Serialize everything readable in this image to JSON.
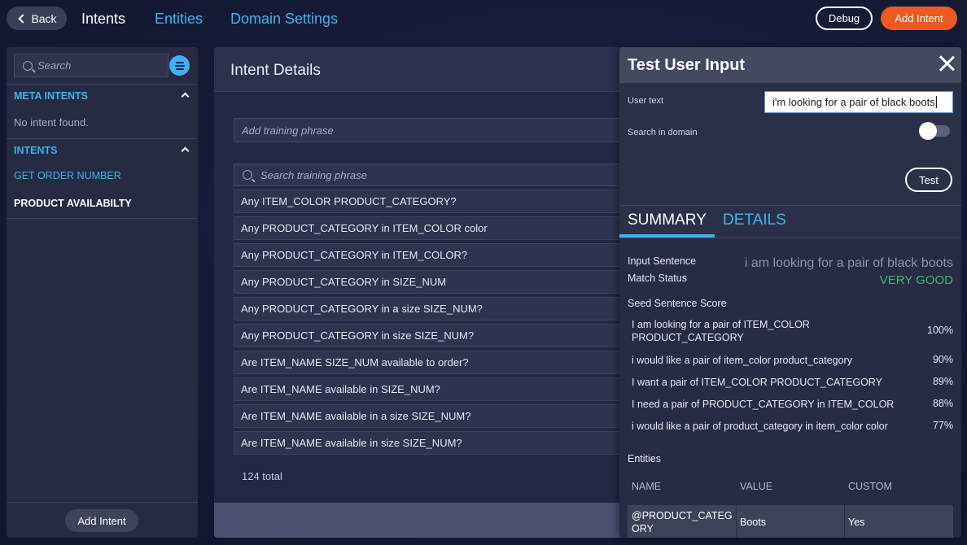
{
  "topbar": {
    "back_label": "Back",
    "nav": {
      "intents": "Intents",
      "entities": "Entities",
      "domain_settings": "Domain Settings"
    },
    "debug_label": "Debug",
    "add_intent_label": "Add Intent"
  },
  "sidebar": {
    "search_placeholder": "Search",
    "meta_intents_heading": "META INTENTS",
    "meta_intents_empty": "No intent found.",
    "intents_heading": "INTENTS",
    "intents": [
      "GET ORDER NUMBER",
      "PRODUCT AVAILABILTY"
    ],
    "add_intent_label": "Add Intent"
  },
  "main": {
    "title": "Intent Details",
    "add_phrase_placeholder": "Add training phrase",
    "search_phrase_placeholder": "Search training phrase",
    "phrases": [
      "Any ITEM_COLOR PRODUCT_CATEGORY?",
      "Any PRODUCT_CATEGORY in ITEM_COLOR color",
      "Any PRODUCT_CATEGORY in ITEM_COLOR?",
      "Any PRODUCT_CATEGORY in SIZE_NUM",
      "Any PRODUCT_CATEGORY in a size SIZE_NUM?",
      "Any PRODUCT_CATEGORY in size SIZE_NUM?",
      "Are ITEM_NAME SIZE_NUM available to order?",
      "Are ITEM_NAME available in SIZE_NUM?",
      "Are ITEM_NAME available in a size SIZE_NUM?",
      "Are ITEM_NAME available in size SIZE_NUM?"
    ],
    "total": "124 total"
  },
  "test_panel": {
    "title": "Test User Input",
    "user_text_label": "User text",
    "user_text_value": "i'm looking for a pair of black boots",
    "search_domain_label": "Search in domain",
    "test_label": "Test",
    "tabs": {
      "summary": "SUMMARY",
      "details": "DETAILS"
    },
    "summary": {
      "input_sentence_label": "Input Sentence",
      "input_sentence_value": "i am looking for a pair of black boots",
      "match_status_label": "Match Status",
      "match_status_value": "VERY GOOD",
      "seed_score_label": "Seed Sentence Score",
      "scores": [
        {
          "sentence": "I am looking for a pair of ITEM_COLOR PRODUCT_CATEGORY",
          "score": "100%"
        },
        {
          "sentence": "i would like a pair of item_color product_category",
          "score": "90%"
        },
        {
          "sentence": "I want a pair of ITEM_COLOR PRODUCT_CATEGORY",
          "score": "89%"
        },
        {
          "sentence": "I need a pair of PRODUCT_CATEGORY in ITEM_COLOR",
          "score": "88%"
        },
        {
          "sentence": "i would like a pair of product_category in item_color color",
          "score": "77%"
        }
      ],
      "entities_label": "Entities",
      "entity_columns": [
        "NAME",
        "VALUE",
        "CUSTOM"
      ],
      "entities": [
        {
          "name": "@PRODUCT_CATEG ORY",
          "value": "Boots",
          "custom": "Yes"
        }
      ]
    }
  },
  "colors": {
    "accent_blue": "#3fb2ef",
    "accent_orange": "#ec5a1f",
    "status_green": "#43b56b"
  }
}
